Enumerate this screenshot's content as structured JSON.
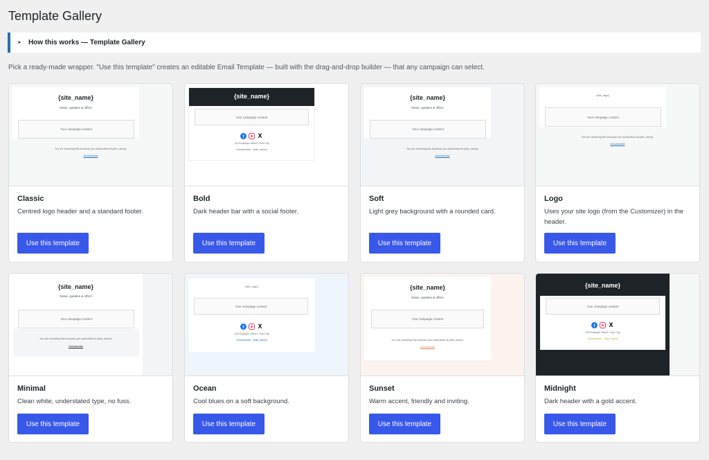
{
  "page": {
    "title": "Template Gallery",
    "howto_label": "How this works — Template Gallery",
    "intro": "Pick a ready-made wrapper. \"Use this template\" creates an editable Email Template — built with the drag-and-drop builder — that any campaign can select."
  },
  "preview": {
    "site_name": "{site_name}",
    "tagline": "News, updates & offers",
    "content": "Your campaign content",
    "footer": "You are receiving this because you subscribed at {site_name}.",
    "unsubscribe": "Unsubscribe",
    "logo": "[site_logo]",
    "address": "123 Example Street, Your City",
    "unsub_site": "Unsubscribe · {site_name}"
  },
  "templates": [
    {
      "name": "Classic",
      "description": "Centred logo header and a standard footer.",
      "button": "Use this template"
    },
    {
      "name": "Bold",
      "description": "Dark header bar with a social footer.",
      "button": "Use this template"
    },
    {
      "name": "Soft",
      "description": "Light grey background with a rounded card.",
      "button": "Use this template"
    },
    {
      "name": "Logo",
      "description": "Uses your site logo (from the Customizer) in the header.",
      "button": "Use this template"
    },
    {
      "name": "Minimal",
      "description": "Clean white, understated type, no fuss.",
      "button": "Use this template"
    },
    {
      "name": "Ocean",
      "description": "Cool blues on a soft background.",
      "button": "Use this template"
    },
    {
      "name": "Sunset",
      "description": "Warm accent, friendly and inviting.",
      "button": "Use this template"
    },
    {
      "name": "Midnight",
      "description": "Dark header with a gold accent.",
      "button": "Use this template"
    }
  ],
  "colors": {
    "accent_button": "#3858e9",
    "howto_border": "#2271b1",
    "dark_header": "#1d2327",
    "gold_accent": "#c9a227",
    "sunset_accent": "#e07b4f"
  },
  "icons": [
    "caret-right-icon",
    "facebook-icon",
    "instagram-icon",
    "x-icon"
  ]
}
